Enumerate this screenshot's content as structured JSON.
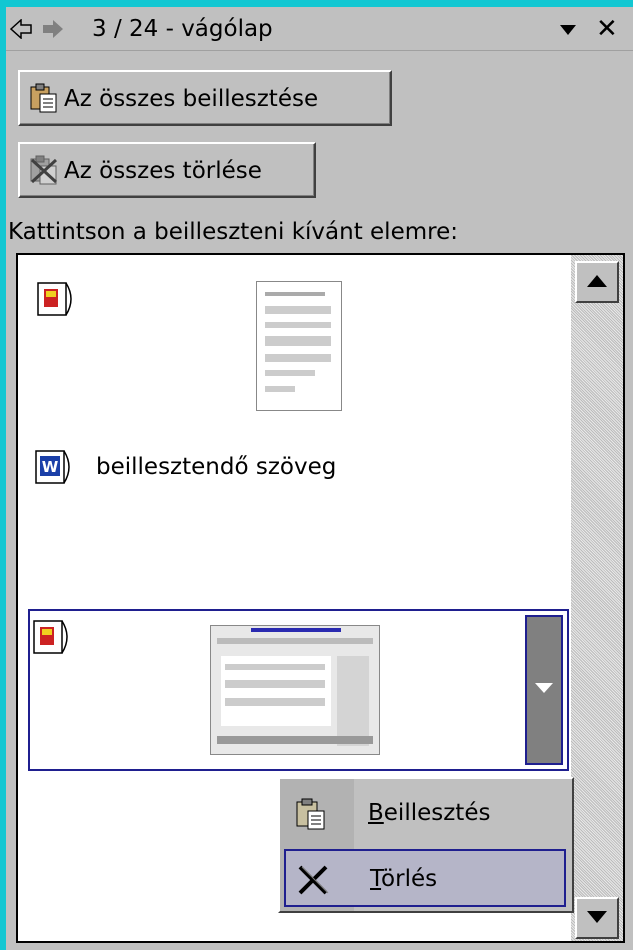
{
  "task_pane": {
    "title": "3 / 24 - vágólap",
    "nav_back_icon": "back-arrow-icon",
    "nav_forward_icon": "forward-arrow-icon",
    "menu_icon": "chevron-down-icon",
    "close_label": "✕"
  },
  "buttons": {
    "paste_all": "Az összes beillesztése",
    "clear_all": "Az összes törlése"
  },
  "instruction": "Kattintson a beilleszteni kívánt elemre:",
  "clipboard_items": [
    {
      "type": "image",
      "icon": "powerpoint-clip-icon"
    },
    {
      "type": "text",
      "icon": "word-clip-icon",
      "text": "beillesztendő szöveg"
    },
    {
      "type": "image",
      "icon": "powerpoint-clip-icon",
      "selected": true
    }
  ],
  "context_menu": {
    "items": [
      {
        "label": "Beillesztés",
        "icon": "paste-icon"
      },
      {
        "label": "Törlés",
        "icon": "delete-icon",
        "highlighted": true
      }
    ]
  },
  "colors": {
    "accent": "#1f1f8f",
    "frame": "#12c7d2",
    "face": "#c0c0c0"
  }
}
